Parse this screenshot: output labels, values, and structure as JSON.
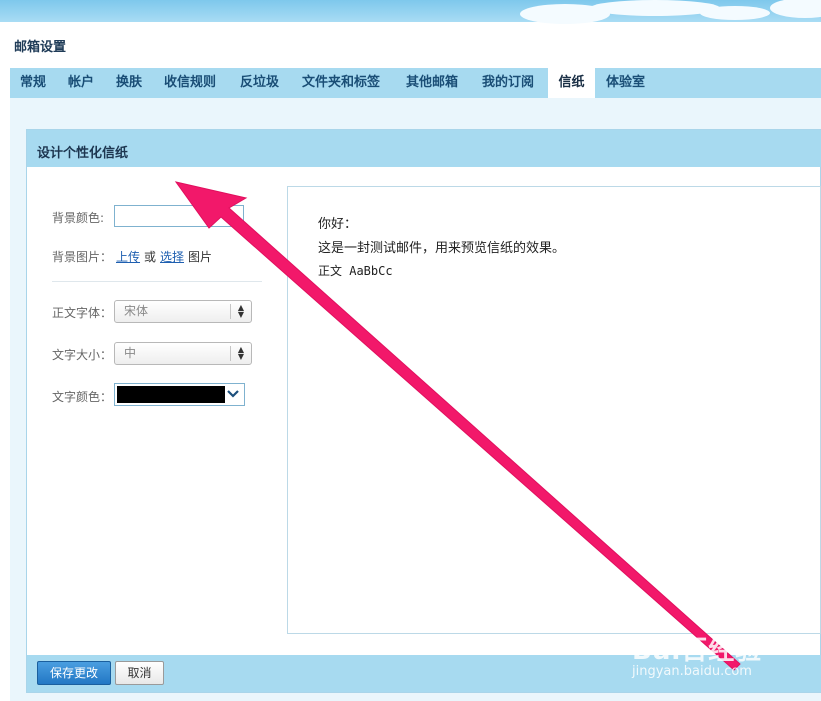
{
  "page": {
    "title": "邮箱设置"
  },
  "tabs": [
    {
      "label": "常规"
    },
    {
      "label": "帐户"
    },
    {
      "label": "换肤"
    },
    {
      "label": "收信规则"
    },
    {
      "label": "反垃圾"
    },
    {
      "label": "文件夹和标签"
    },
    {
      "label": "其他邮箱"
    },
    {
      "label": "我的订阅"
    },
    {
      "label": "信纸",
      "active": true
    },
    {
      "label": "体验室"
    }
  ],
  "panel": {
    "title": "设计个性化信纸"
  },
  "form": {
    "bg_color_label": "背景颜色:",
    "bg_color_value": "",
    "bg_image_label": "背景图片：",
    "upload_link": "上传",
    "or_text": "或",
    "choose_link": "选择",
    "image_text": "图片",
    "font_label": "正文字体：",
    "font_value": "宋体",
    "size_label": "文字大小：",
    "size_value": "中",
    "text_color_label": "文字颜色：",
    "text_color_value": "#000000"
  },
  "preview": {
    "line1": "你好：",
    "line2": "这是一封测试邮件，用来预览信纸的效果。",
    "line3": "正文 AaBbCc"
  },
  "footer": {
    "save_label": "保存更改",
    "cancel_label": "取消"
  },
  "watermark": {
    "logo": "Bai百经验",
    "url": "jingyan.baidu.com"
  },
  "colors": {
    "tab_bar": "#a7daf0",
    "annotation_arrow": "#f2186a",
    "primary_button": "#2277c4"
  }
}
